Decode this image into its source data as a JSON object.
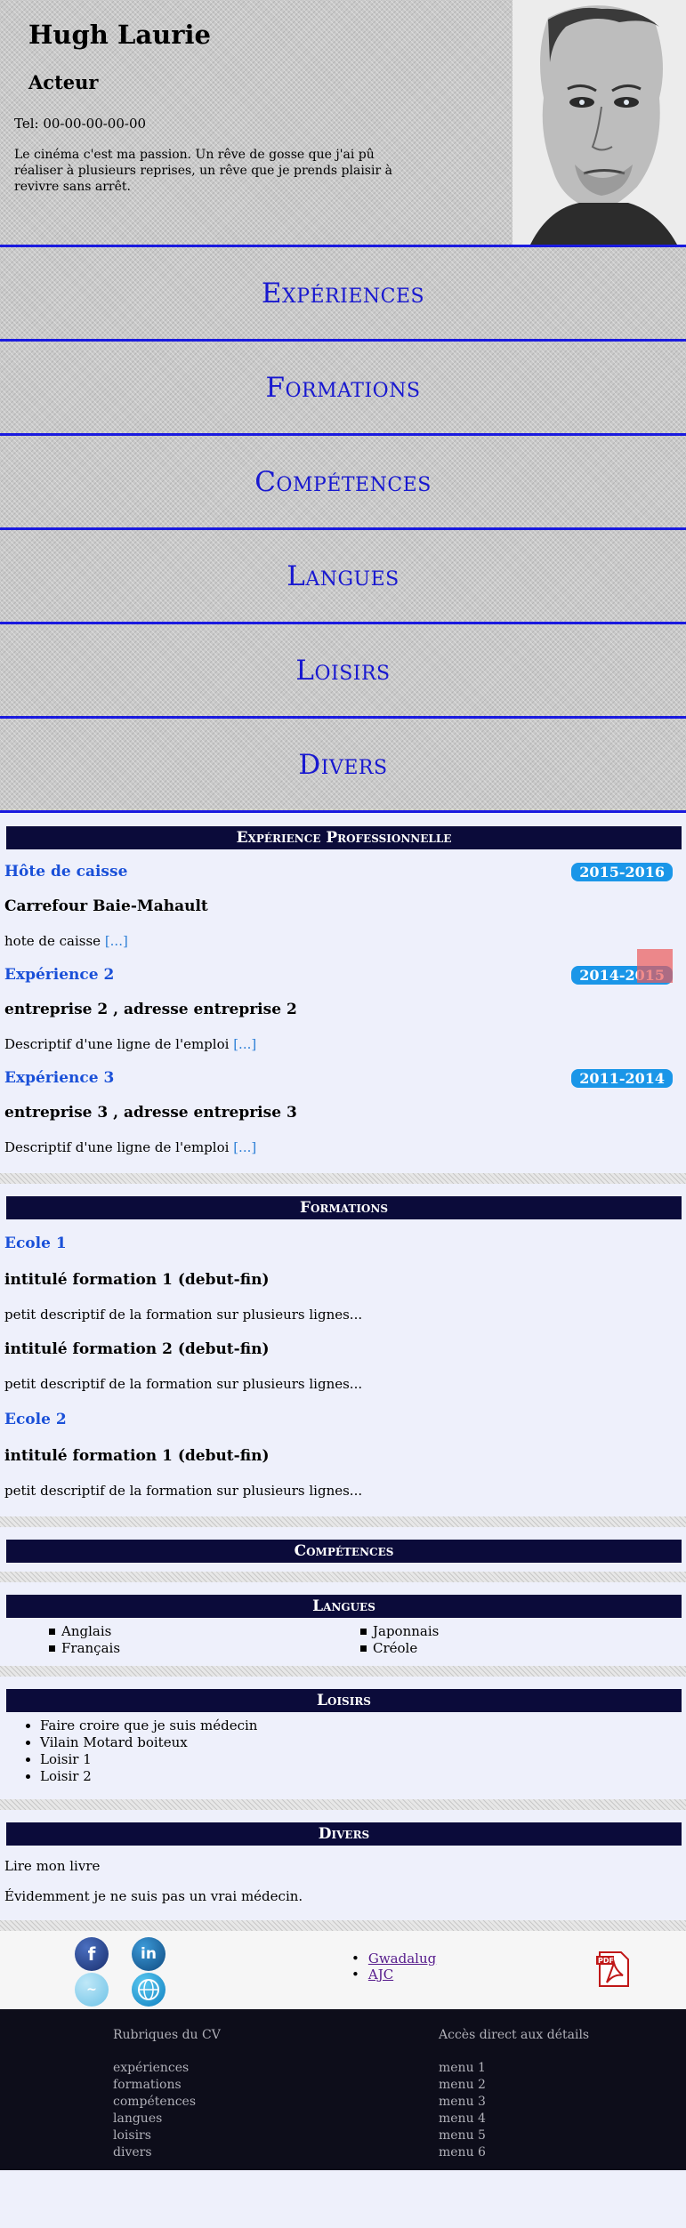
{
  "header": {
    "name": "Hugh Laurie",
    "job": "Acteur",
    "tel": "Tel: 00-00-00-00-00",
    "bio": "Le cinéma c'est ma passion. Un rêve de gosse que j'ai pû réaliser à plusieurs reprises, un rêve que je prends plaisir à revivre sans arrêt."
  },
  "nav": [
    "Expériences",
    "Formations",
    "Compétences",
    "Langues",
    "Loisirs",
    "Divers"
  ],
  "experience": {
    "title": "Expérience Professionnelle",
    "more_label": "[...]",
    "jobs": [
      {
        "title": "Hôte de caisse",
        "dates": "2015-2016",
        "company": "Carrefour Baie-Mahault",
        "desc": "hote de caisse"
      },
      {
        "title": "Expérience 2",
        "dates": "2014-2015",
        "company": "entreprise 2 , adresse entreprise 2",
        "desc": "Descriptif d'une ligne de l'emploi"
      },
      {
        "title": "Expérience 3",
        "dates": "2011-2014",
        "company": "entreprise 3 , adresse entreprise 3",
        "desc": "Descriptif d'une ligne de l'emploi"
      }
    ]
  },
  "formations": {
    "title": "Formations",
    "school1": "Ecole 1",
    "school2": "Ecole 2",
    "f1": {
      "title": "intitulé formation 1 (debut-fin)",
      "desc": "petit descriptif de la formation sur plusieurs lignes..."
    },
    "f2": {
      "title": "intitulé formation 2 (debut-fin)",
      "desc": "petit descriptif de la formation sur plusieurs lignes..."
    },
    "f3": {
      "title": "intitulé formation 1 (debut-fin)",
      "desc": "petit descriptif de la formation sur plusieurs lignes..."
    }
  },
  "competences": {
    "title": "Compétences"
  },
  "langues": {
    "title": "Langues",
    "items": [
      "Anglais",
      "Japonnais",
      "Français",
      "Créole"
    ]
  },
  "loisirs": {
    "title": "Loisirs",
    "items": [
      "Faire croire que je suis médecin",
      "Vilain Motard boiteux",
      "Loisir 1",
      "Loisir 2"
    ]
  },
  "divers": {
    "title": "Divers",
    "lines": [
      "Lire mon livre",
      "Évidemment je ne suis pas un vrai médecin."
    ]
  },
  "footer": {
    "links": [
      "Gwadalug",
      "AJC"
    ],
    "social": [
      "facebook-icon",
      "linkedin-icon",
      "twitter-icon",
      "globe-icon"
    ],
    "col1": {
      "title": "Rubriques du CV",
      "items": [
        "expériences",
        "formations",
        "compétences",
        "langues",
        "loisirs",
        "divers"
      ]
    },
    "col2": {
      "title": "Accès direct aux détails",
      "items": [
        "menu 1",
        "menu 2",
        "menu 3",
        "menu 4",
        "menu 5",
        "menu 6"
      ]
    }
  },
  "colors": {
    "accent": "#1a1adf",
    "nav_text": "#1818d0",
    "title_bar": "#0b0b3a",
    "badge": "#1a96e8",
    "job_title": "#1a50d8",
    "footer_bg": "#0d0d1a"
  }
}
